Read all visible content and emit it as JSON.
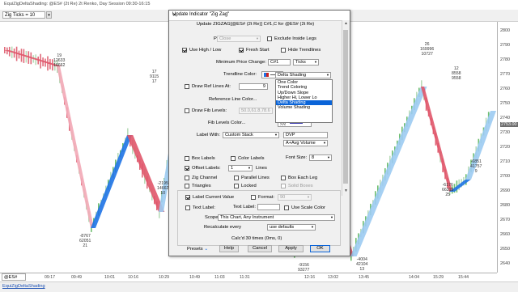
{
  "window": {
    "title": "EquiZigDeltaShading: @ES# (2t Re) 2t Renko, Day Session 09:30-16:15"
  },
  "toolbar": {
    "ticks_value": "Zig Ticks = 10"
  },
  "chart": {
    "symbol": "@ES#",
    "y_axis": [
      "2800",
      "2790",
      "2780",
      "2770",
      "2760",
      "2750",
      "2740",
      "2730",
      "2720",
      "2710",
      "2700",
      "2690",
      "2680",
      "2670",
      "2660",
      "2650",
      "2640"
    ],
    "y_highlight": "2753.00",
    "x_axis": [
      "09:17",
      "09:49",
      "10:01",
      "10:16",
      "10:29",
      "10:49",
      "11:03",
      "11:31",
      "12:16",
      "13:02",
      "13:45",
      "14:04",
      "15:29",
      "15:44"
    ],
    "annotations": [
      {
        "lines": [
          "19",
          "12633",
          "16662"
        ]
      },
      {
        "lines": [
          "17",
          "9115",
          "17"
        ]
      },
      {
        "lines": [
          "-8767",
          "62051",
          "21"
        ]
      },
      {
        "lines": [
          "-2195",
          "14662",
          "10"
        ]
      },
      {
        "lines": [
          "-9156",
          "93277",
          "13"
        ]
      },
      {
        "lines": [
          "-4004",
          "42104",
          "13"
        ]
      },
      {
        "lines": [
          "26",
          "169996",
          "10727"
        ]
      },
      {
        "lines": [
          "12",
          "8558",
          "9558"
        ]
      },
      {
        "lines": [
          "-6176",
          "66315",
          "25"
        ]
      },
      {
        "lines": [
          "-6851",
          "41757",
          "9"
        ]
      }
    ]
  },
  "dialog": {
    "title": "Update Indicator \"Zig Zag\"",
    "subtitle": "Update ZIGZAG[@ES# (2t Re)] C#1,C  for  @ES# (2t Re)",
    "price_label": "Price:",
    "price_value": "Close",
    "exclude_inside_legs": "Exclude Inside Legs",
    "use_high_low": "Use High / Low",
    "fresh_start": "Fresh Start",
    "hide_trendlines": "Hide Trendlines",
    "min_price_change_label": "Minimum Price Change:",
    "min_price_change_value": "C#1",
    "min_price_change_unit": "Ticks",
    "trendline_color_label": "Trendline Color:",
    "trendline_color_accent": "#cc2222",
    "draw_ref_lines": "Draw Ref Lines At:",
    "ref_lines_value": "9",
    "ref_line_color_label": "Reference Line Color...",
    "draw_fib_levels": "Draw Fib Levels:",
    "fib_levels_value": "50.0,61.8,78.6",
    "fib_levels_color_label": "Fib Levels Color...",
    "label_with_label": "Label With:",
    "label_with_value": "Custom Stack",
    "label_stack_value": "DVP",
    "label_extra_value": "A+Avg Volume",
    "shading_value": "Delta Shading",
    "shading_options": [
      "One Color",
      "Trend Coloring",
      "Up/Down Slope",
      "Higher Hi, Lower Lo",
      "Delta Shading",
      "Volume Shading"
    ],
    "shading_selected_index": 4,
    "box_labels": "Box Labels",
    "color_labels": "Color Labels",
    "font_size_label": "Font Size:",
    "font_size_value": "8",
    "offset_labels": "Offset Labels:",
    "offset_value": "1",
    "lines_label": "Lines",
    "zig_channel": "Zig Channel",
    "parallel_lines": "Parallel Lines",
    "box_each_leg": "Box Each Leg",
    "triangles": "Triangles",
    "locked": "Locked",
    "solid_boxes": "Solid Boxes",
    "label_current_value": "Label Current Value",
    "format_label": "Format:",
    "format_value": "90",
    "text_label": "Text Label:",
    "text_label_2": "Text Label:",
    "use_scale_color": "Use Scale Color",
    "scope_label": "Scope:",
    "scope_value": "This Chart, Any Instrument",
    "recalculate_label": "Recalculate every",
    "recalculate_value": "use defaults",
    "calc_status": "Calc'd 30 times (0ms, 0)",
    "presets": "Presets",
    "help": "Help",
    "cancel": "Cancel",
    "apply": "Apply",
    "ok": "OK"
  },
  "statusbar": {
    "tab": "EquiZigDeltaShading"
  },
  "colors": {
    "up": "#1e73e6",
    "down": "#e0566a",
    "up_light": "#9ccbf2",
    "down_light": "#f2a9b6"
  }
}
